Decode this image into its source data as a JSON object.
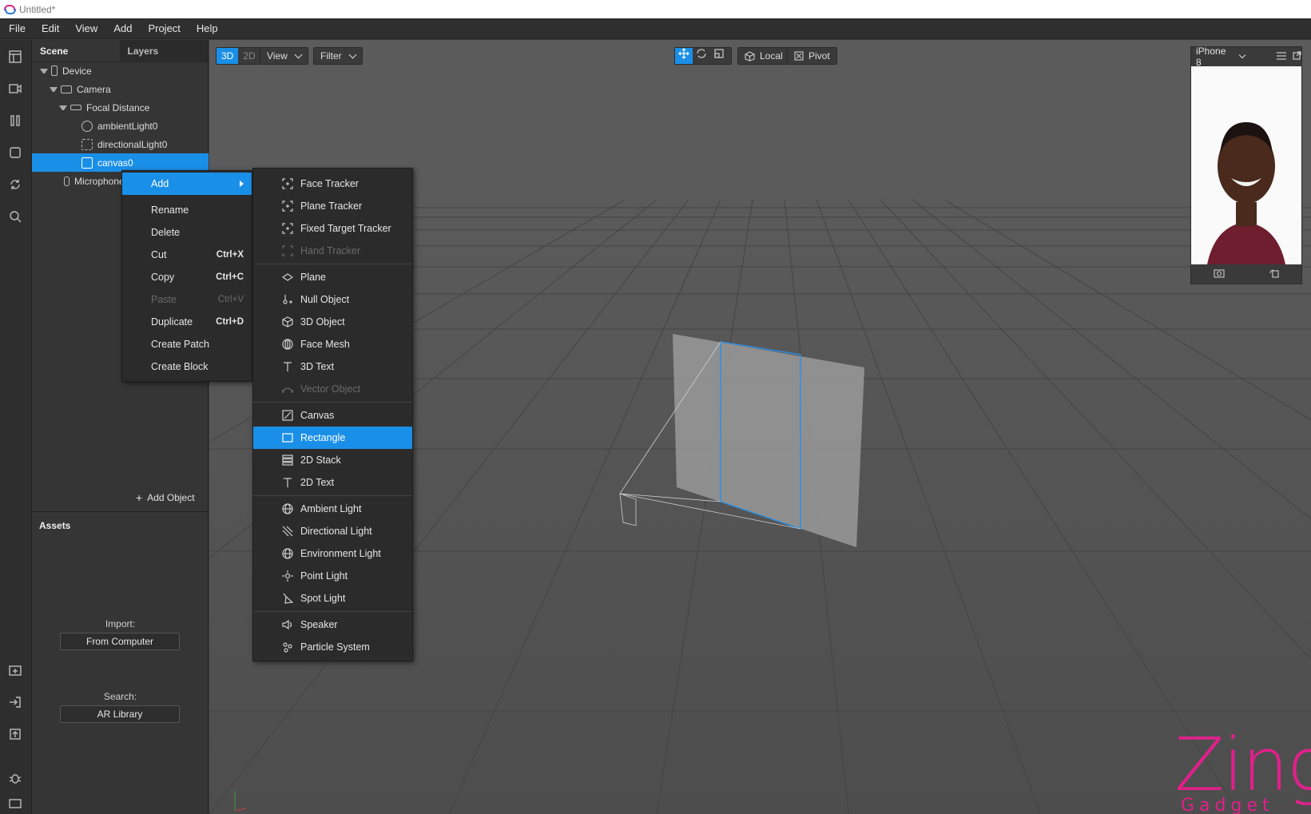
{
  "window": {
    "title": "Untitled*"
  },
  "menubar": {
    "items": [
      "File",
      "Edit",
      "View",
      "Add",
      "Project",
      "Help"
    ]
  },
  "scene_panel": {
    "tabs": [
      "Scene",
      "Layers"
    ],
    "tree": [
      {
        "label": "Device",
        "level": 0,
        "expanded": true,
        "icon": "phone-icon"
      },
      {
        "label": "Camera",
        "level": 1,
        "expanded": true,
        "icon": "camera-icon"
      },
      {
        "label": "Focal Distance",
        "level": 2,
        "expanded": true,
        "icon": "ruler-icon"
      },
      {
        "label": "ambientLight0",
        "level": 3,
        "icon": "ambient-light-icon"
      },
      {
        "label": "directionalLight0",
        "level": 3,
        "icon": "directional-light-icon"
      },
      {
        "label": "canvas0",
        "level": 3,
        "icon": "canvas-icon",
        "selected": true
      },
      {
        "label": "Microphone",
        "level": 1,
        "icon": "microphone-icon"
      }
    ],
    "add_object_label": "Add Object"
  },
  "assets_panel": {
    "title": "Assets",
    "import_label": "Import:",
    "import_button": "From Computer",
    "search_label": "Search:",
    "search_button": "AR Library"
  },
  "viewport_toolbar": {
    "mode_3d": "3D",
    "mode_2d": "2D",
    "view_dropdown": "View",
    "filter_dropdown": "Filter",
    "local_label": "Local",
    "pivot_label": "Pivot"
  },
  "preview": {
    "device": "iPhone 8"
  },
  "context_menu": {
    "items": [
      {
        "label": "Add",
        "highlighted": true,
        "submenu": true
      },
      {
        "label": "Rename"
      },
      {
        "label": "Delete"
      },
      {
        "label": "Cut",
        "shortcut": "Ctrl+X"
      },
      {
        "label": "Copy",
        "shortcut": "Ctrl+C"
      },
      {
        "label": "Paste",
        "shortcut": "Ctrl+V",
        "disabled": true
      },
      {
        "label": "Duplicate",
        "shortcut": "Ctrl+D"
      },
      {
        "label": "Create Patch"
      },
      {
        "label": "Create Block"
      }
    ]
  },
  "add_submenu": {
    "groups": [
      [
        {
          "label": "Face Tracker",
          "icon": "tracker-icon"
        },
        {
          "label": "Plane Tracker",
          "icon": "tracker-icon"
        },
        {
          "label": "Fixed Target Tracker",
          "icon": "tracker-icon"
        },
        {
          "label": "Hand Tracker",
          "icon": "tracker-icon",
          "disabled": true
        }
      ],
      [
        {
          "label": "Plane",
          "icon": "plane-icon"
        },
        {
          "label": "Null Object",
          "icon": "null-object-icon"
        },
        {
          "label": "3D Object",
          "icon": "cube-icon"
        },
        {
          "label": "Face Mesh",
          "icon": "face-mesh-icon"
        },
        {
          "label": "3D Text",
          "icon": "text-icon"
        },
        {
          "label": "Vector Object",
          "icon": "vector-icon",
          "disabled": true
        }
      ],
      [
        {
          "label": "Canvas",
          "icon": "canvas-icon"
        },
        {
          "label": "Rectangle",
          "icon": "rectangle-icon",
          "highlighted": true
        },
        {
          "label": "2D Stack",
          "icon": "stack-icon"
        },
        {
          "label": "2D Text",
          "icon": "text-icon"
        }
      ],
      [
        {
          "label": "Ambient Light",
          "icon": "globe-icon"
        },
        {
          "label": "Directional Light",
          "icon": "directional-light-icon"
        },
        {
          "label": "Environment Light",
          "icon": "globe-icon"
        },
        {
          "label": "Point Light",
          "icon": "sun-icon"
        },
        {
          "label": "Spot Light",
          "icon": "spotlight-icon"
        }
      ],
      [
        {
          "label": "Speaker",
          "icon": "speaker-icon"
        },
        {
          "label": "Particle System",
          "icon": "particles-icon"
        }
      ]
    ]
  },
  "watermark": {
    "brand": "Zing",
    "sub": "Gadget",
    "color": "#e0208a"
  },
  "colors": {
    "accent": "#1a8fe8",
    "panel": "#353535",
    "viewport": "#5b5b5b"
  }
}
